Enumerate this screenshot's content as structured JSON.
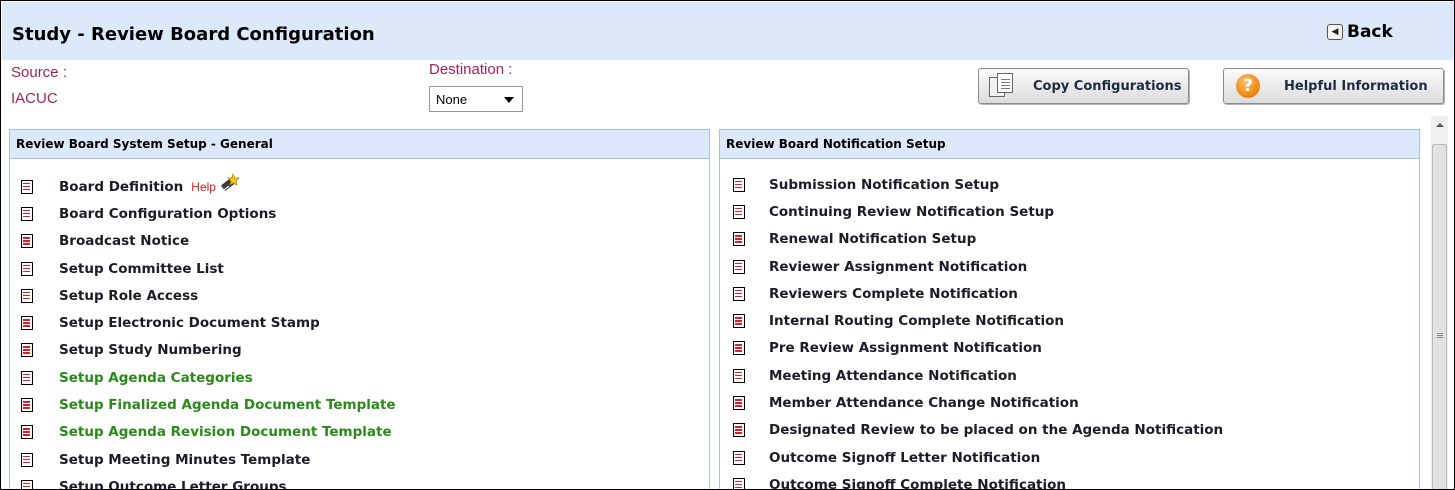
{
  "header": {
    "title": "Study - Review Board Configuration",
    "back_label": "Back"
  },
  "source": {
    "label": "Source :",
    "value": "IACUC"
  },
  "destination": {
    "label": "Destination :",
    "selected": "None"
  },
  "buttons": {
    "copy": "Copy Configurations",
    "help": "Helpful Information"
  },
  "left_panel": {
    "title": "Review Board System Setup - General",
    "help_link": "Help",
    "items": [
      {
        "label": "Board Definition"
      },
      {
        "label": "Board Configuration Options"
      },
      {
        "label": "Broadcast Notice"
      },
      {
        "label": "Setup Committee List"
      },
      {
        "label": "Setup Role Access"
      },
      {
        "label": "Setup Electronic Document Stamp"
      },
      {
        "label": "Setup Study Numbering"
      },
      {
        "label": "Setup Agenda Categories"
      },
      {
        "label": "Setup Finalized Agenda Document Template"
      },
      {
        "label": "Setup Agenda Revision Document Template"
      },
      {
        "label": "Setup Meeting Minutes Template"
      },
      {
        "label": "Setup Outcome Letter Groups"
      }
    ]
  },
  "right_panel": {
    "title": "Review Board  Notification Setup",
    "items": [
      {
        "label": "Submission Notification Setup"
      },
      {
        "label": "Continuing Review Notification Setup"
      },
      {
        "label": "Renewal Notification Setup"
      },
      {
        "label": "Reviewer Assignment Notification"
      },
      {
        "label": "Reviewers Complete Notification"
      },
      {
        "label": "Internal Routing Complete Notification"
      },
      {
        "label": "Pre Review Assignment Notification"
      },
      {
        "label": "Meeting Attendance Notification"
      },
      {
        "label": "Member Attendance Change Notification"
      },
      {
        "label": "Designated Review to be placed on the Agenda Notification"
      },
      {
        "label": "Outcome Signoff Letter Notification"
      },
      {
        "label": "Outcome Signoff Complete Notification"
      }
    ]
  },
  "colors": {
    "header_bg": "#dce9fa",
    "label_accent": "#a0245a",
    "green_link": "#2a8a19",
    "help_red": "#e01616"
  }
}
